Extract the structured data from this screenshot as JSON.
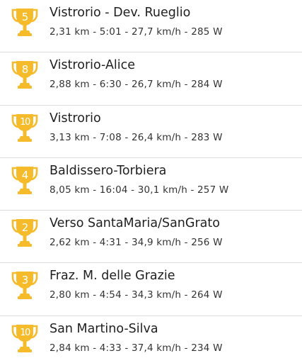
{
  "colors": {
    "trophy": "#F5BB2A",
    "divider": "#DCDCDC",
    "title_text": "#1F1F1F",
    "stats_text": "#333333"
  },
  "segments": [
    {
      "rank": "5",
      "icon": "trophy-icon",
      "name": "Vistrorio - Dev. Rueglio",
      "stats": "2,31 km - 5:01 - 27,7 km/h - 285 W"
    },
    {
      "rank": "8",
      "icon": "trophy-icon",
      "name": "Vistrorio-Alice",
      "stats": "2,88 km - 6:30 - 26,7 km/h - 284 W"
    },
    {
      "rank": "10",
      "icon": "trophy-icon",
      "name": "Vistrorio",
      "stats": "3,13 km - 7:08 - 26,4 km/h - 283 W"
    },
    {
      "rank": "4",
      "icon": "trophy-icon",
      "name": "Baldissero-Torbiera",
      "stats": "8,05 km - 16:04 - 30,1 km/h - 257 W"
    },
    {
      "rank": "2",
      "icon": "trophy-icon",
      "name": "Verso SantaMaria/SanGrato",
      "stats": "2,62 km - 4:31 - 34,9 km/h - 256 W"
    },
    {
      "rank": "3",
      "icon": "trophy-icon",
      "name": "Fraz. M. delle Grazie",
      "stats": "2,80 km - 4:54 - 34,3 km/h - 264 W"
    },
    {
      "rank": "10",
      "icon": "trophy-icon",
      "name": "San Martino-Silva",
      "stats": "2,84 km - 4:33 - 37,4 km/h - 234 W"
    }
  ]
}
